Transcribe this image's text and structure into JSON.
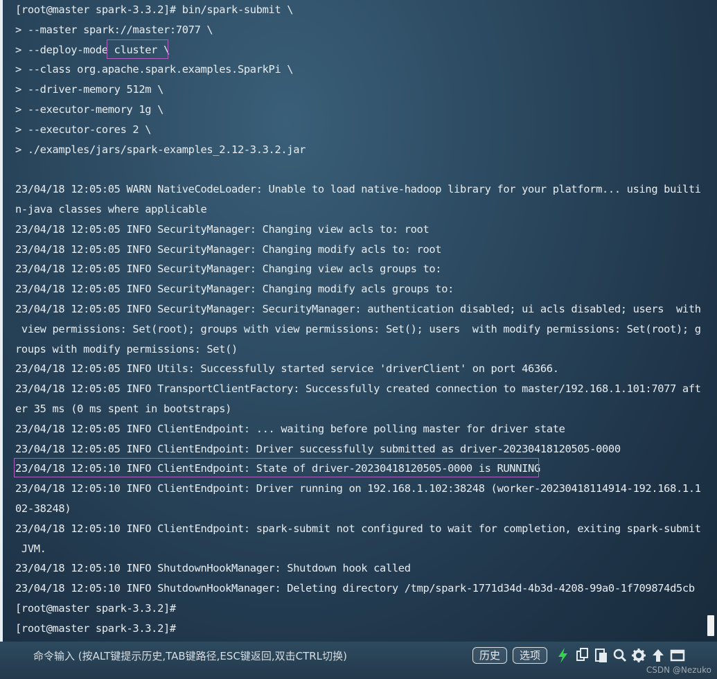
{
  "terminal": {
    "lines": [
      "[root@master spark-3.3.2]# bin/spark-submit \\",
      "> --master spark://master:7077 \\",
      "> --deploy-mode cluster \\",
      "> --class org.apache.spark.examples.SparkPi \\",
      "> --driver-memory 512m \\",
      "> --executor-memory 1g \\",
      "> --executor-cores 2 \\",
      "> ./examples/jars/spark-examples_2.12-3.3.2.jar",
      "",
      "23/04/18 12:05:05 WARN NativeCodeLoader: Unable to load native-hadoop library for your platform... using builti",
      "n-java classes where applicable",
      "23/04/18 12:05:05 INFO SecurityManager: Changing view acls to: root",
      "23/04/18 12:05:05 INFO SecurityManager: Changing modify acls to: root",
      "23/04/18 12:05:05 INFO SecurityManager: Changing view acls groups to:",
      "23/04/18 12:05:05 INFO SecurityManager: Changing modify acls groups to:",
      "23/04/18 12:05:05 INFO SecurityManager: SecurityManager: authentication disabled; ui acls disabled; users  with",
      " view permissions: Set(root); groups with view permissions: Set(); users  with modify permissions: Set(root); g",
      "roups with modify permissions: Set()",
      "23/04/18 12:05:05 INFO Utils: Successfully started service 'driverClient' on port 46366.",
      "23/04/18 12:05:05 INFO TransportClientFactory: Successfully created connection to master/192.168.1.101:7077 aft",
      "er 35 ms (0 ms spent in bootstraps)",
      "23/04/18 12:05:05 INFO ClientEndpoint: ... waiting before polling master for driver state",
      "23/04/18 12:05:05 INFO ClientEndpoint: Driver successfully submitted as driver-20230418120505-0000",
      "23/04/18 12:05:10 INFO ClientEndpoint: State of driver-20230418120505-0000 is RUNNING",
      "23/04/18 12:05:10 INFO ClientEndpoint: Driver running on 192.168.1.102:38248 (worker-20230418114914-192.168.1.1",
      "02-38248)",
      "23/04/18 12:05:10 INFO ClientEndpoint: spark-submit not configured to wait for completion, exiting spark-submit",
      " JVM.",
      "23/04/18 12:05:10 INFO ShutdownHookManager: Shutdown hook called",
      "23/04/18 12:05:10 INFO ShutdownHookManager: Deleting directory /tmp/spark-1771d34d-4b3d-4208-99a0-1f709874d5cb",
      "[root@master spark-3.3.2]#",
      "[root@master spark-3.3.2]#"
    ]
  },
  "bottom_bar": {
    "command_input": "命令输入 (按ALT键提示历史,TAB键路径,ESC键返回,双击CTRL切换)",
    "history_button": "历史",
    "options_button": "选项"
  },
  "watermark": "CSDN @Nezuko",
  "colors": {
    "terminal_text": "#e8edf1",
    "highlight_border": "#b060c0",
    "lightning_icon": "#39d353"
  }
}
